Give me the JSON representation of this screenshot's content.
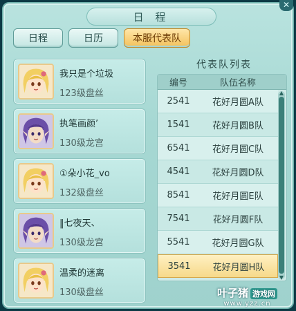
{
  "window": {
    "title": "日 程",
    "close": "✕"
  },
  "tabs": [
    {
      "label": "日程",
      "active": false
    },
    {
      "label": "日历",
      "active": false
    },
    {
      "label": "本服代表队",
      "active": true
    }
  ],
  "players": [
    {
      "name": "我只是个垃圾",
      "level": "123级盘丝",
      "avatar": "blonde-girl-avatar"
    },
    {
      "name": "执笔画颜’",
      "level": "130级龙宫",
      "avatar": "purple-hair-avatar"
    },
    {
      "name": "①朵小花_vo",
      "level": "132级盘丝",
      "avatar": "blonde-girl-avatar"
    },
    {
      "name": "‖七夜天、",
      "level": "130级龙宫",
      "avatar": "purple-hair-avatar"
    },
    {
      "name": "温柔的迷离",
      "level": "130级盘丝",
      "avatar": "blonde-girl-avatar"
    }
  ],
  "team_list": {
    "title": "代表队列表",
    "columns": [
      "编号",
      "队伍名称"
    ],
    "rows": [
      {
        "id": "2541",
        "name": "花好月圆A队"
      },
      {
        "id": "1541",
        "name": "花好月圆B队"
      },
      {
        "id": "6541",
        "name": "花好月圆C队"
      },
      {
        "id": "4541",
        "name": "花好月圆D队"
      },
      {
        "id": "8541",
        "name": "花好月圆E队"
      },
      {
        "id": "7541",
        "name": "花好月圆F队"
      },
      {
        "id": "5541",
        "name": "花好月圆G队"
      },
      {
        "id": "3541",
        "name": "花好月圆H队"
      }
    ],
    "selected_index": 7
  },
  "watermark": {
    "main": "叶子猪",
    "badge": "游戏网",
    "url": "www.yzz.cn"
  }
}
